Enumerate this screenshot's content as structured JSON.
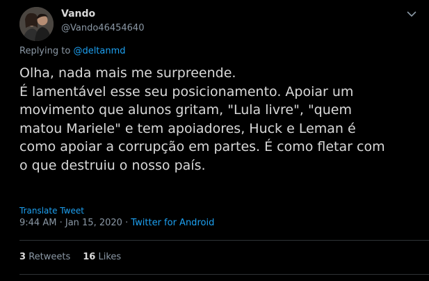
{
  "author": {
    "name": "Vando",
    "handle": "@Vando46454640"
  },
  "reply": {
    "prefix": "Replying to",
    "mention": "@deltanmd"
  },
  "tweet": {
    "lines": [
      "Olha, nada mais me surpreende.",
      "É lamentável esse seu posicionamento. Apoiar um",
      "movimento que alunos gritam, \"Lula livre\", \"quem",
      "matou Mariele\" e tem apoiadores, Huck e Leman é",
      "como apoiar a corrupção em partes. É como fletar com",
      "o que destruiu o nosso país."
    ]
  },
  "translate_label": "Translate Tweet",
  "meta": {
    "time": "9:44 AM",
    "date": "Jan 15, 2020",
    "separator": "·",
    "source": "Twitter for Android"
  },
  "stats": {
    "retweets_count": "3",
    "retweets_label": "Retweets",
    "likes_count": "16",
    "likes_label": "Likes"
  },
  "icons": {
    "menu": "chevron-down-icon"
  },
  "colors": {
    "background": "#000000",
    "text": "#d9d9d9",
    "secondary": "#8b98a5",
    "accent": "#1da1f2",
    "divider": "#2f3336"
  }
}
